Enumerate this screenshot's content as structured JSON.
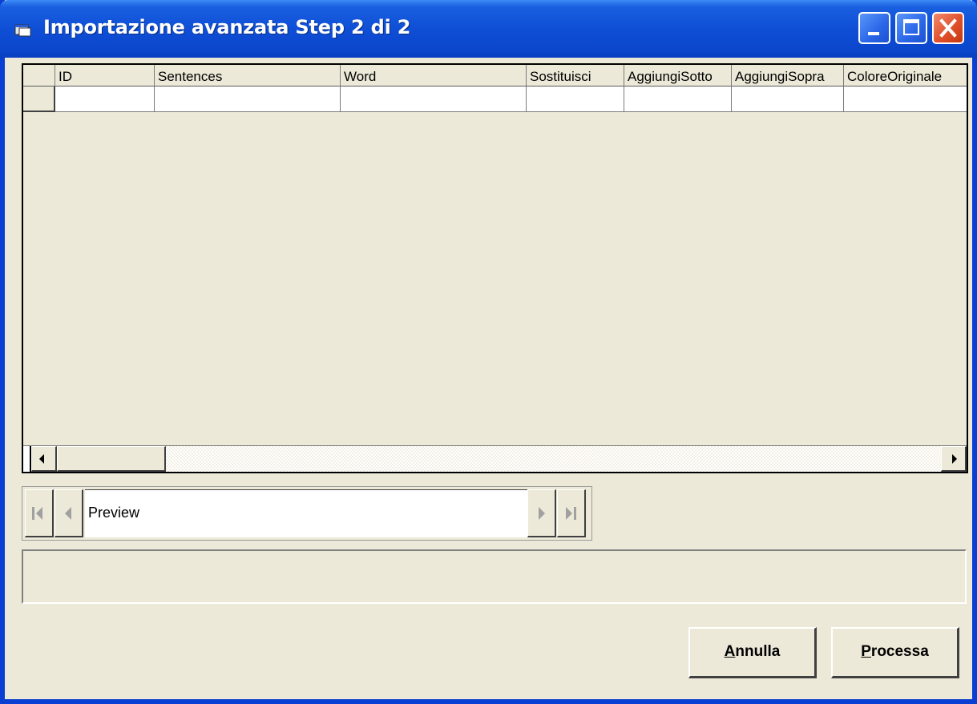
{
  "window": {
    "title": "Importazione avanzata Step 2 di 2"
  },
  "titlebar_buttons": {
    "minimize": "minimize",
    "maximize": "maximize",
    "close": "close"
  },
  "grid": {
    "columns": [
      "",
      "ID",
      "Sentences",
      "Word",
      "Sostituisci",
      "AggiungiSotto",
      "AggiungiSopra",
      "ColoreOriginale"
    ],
    "rows": [
      [
        "",
        "",
        "",
        "",
        "",
        "",
        "",
        ""
      ]
    ]
  },
  "navigator": {
    "caption": "Preview"
  },
  "status_text": "",
  "buttons": {
    "cancel_mnemonic": "A",
    "cancel_rest": "nnulla",
    "process_mnemonic": "P",
    "process_rest": "rocessa"
  },
  "colors": {
    "titlebar": "#0a3fd4",
    "face": "#ece9d8",
    "close": "#e1502c"
  }
}
